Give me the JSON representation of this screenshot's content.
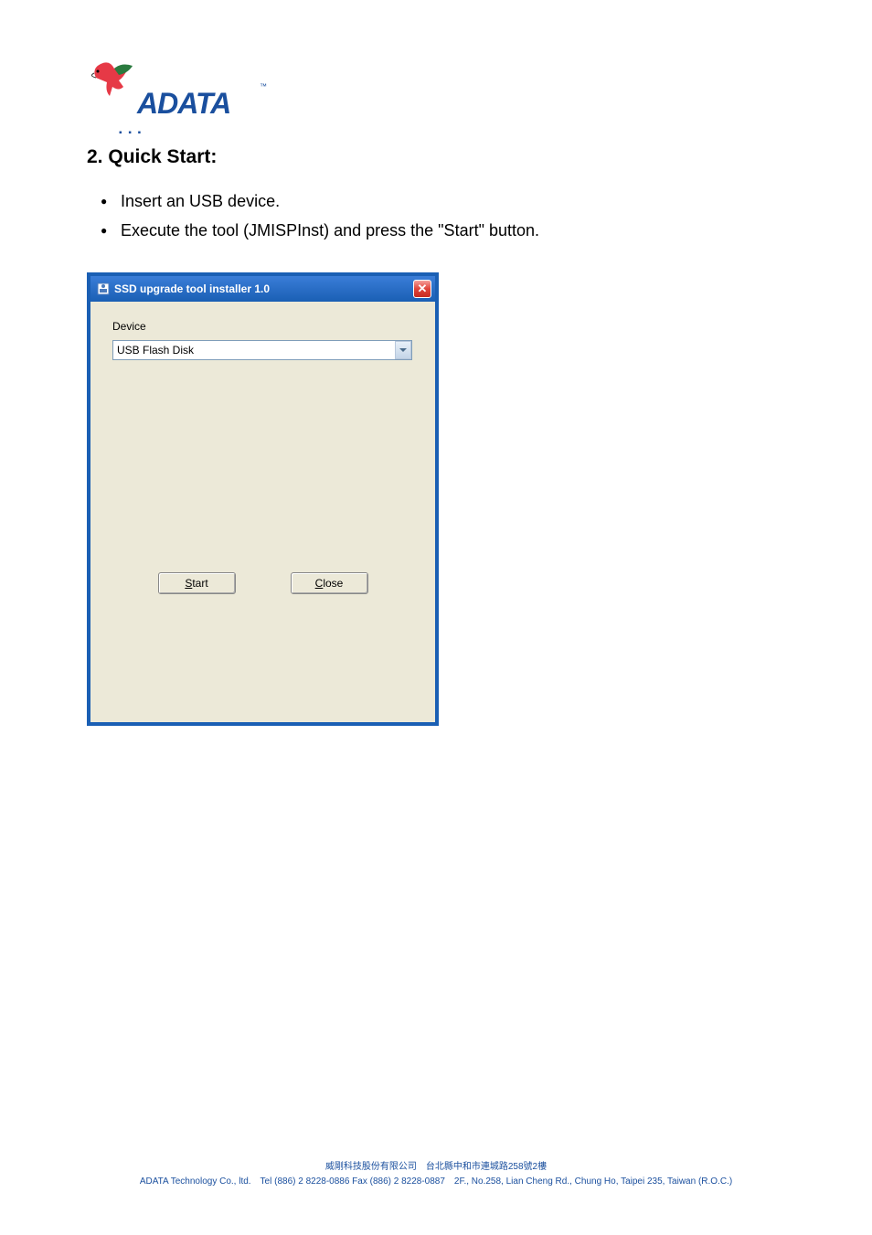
{
  "logo": {
    "brand": "ADATA",
    "tm": "™"
  },
  "section": {
    "number": "2.",
    "title": "Quick Start:"
  },
  "bullets": [
    "Insert an USB device.",
    "Execute the tool (JMISPInst) and press the \"Start\" button."
  ],
  "dialog": {
    "title": "SSD upgrade tool installer 1.0",
    "close_label": "✕",
    "device_label": "Device",
    "device_value": "USB Flash Disk",
    "buttons": {
      "start": "Start",
      "start_underline": "S",
      "close": "Close",
      "close_underline": "C"
    }
  },
  "footer": {
    "line1": "威剛科技股份有限公司　台北縣中和市連城路258號2樓",
    "line2": "ADATA Technology Co., ltd.　Tel (886) 2 8228-0886  Fax (886) 2 8228-0887　2F., No.258, Lian Cheng Rd., Chung Ho, Taipei  235, Taiwan (R.O.C.)"
  }
}
